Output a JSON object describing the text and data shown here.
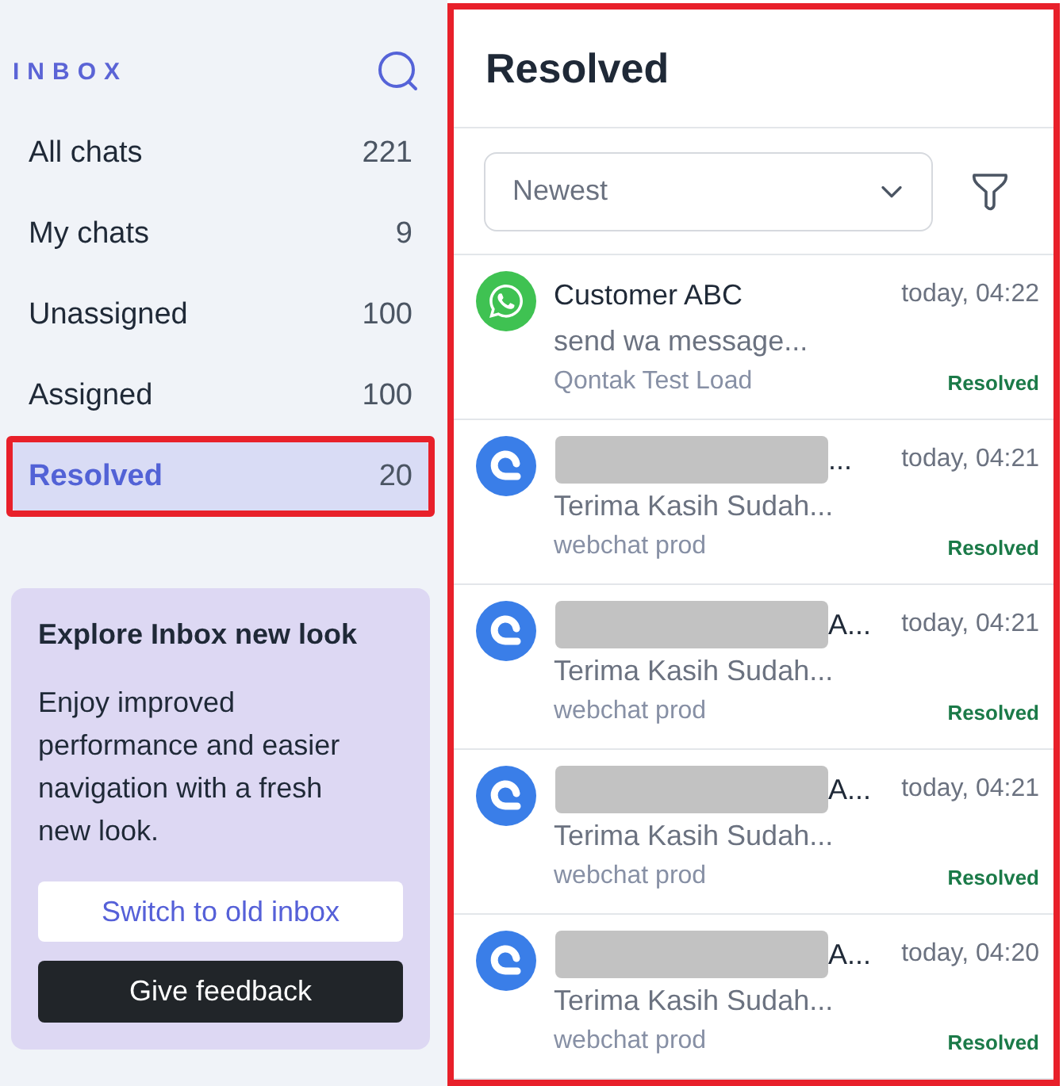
{
  "sidebar": {
    "title": "INBOX",
    "items": [
      {
        "label": "All chats",
        "count": "221",
        "selected": false,
        "highlighted": false
      },
      {
        "label": "My chats",
        "count": "9",
        "selected": false,
        "highlighted": false
      },
      {
        "label": "Unassigned",
        "count": "100",
        "selected": false,
        "highlighted": false
      },
      {
        "label": "Assigned",
        "count": "100",
        "selected": false,
        "highlighted": false
      },
      {
        "label": "Resolved",
        "count": "20",
        "selected": true,
        "highlighted": true
      }
    ]
  },
  "promo": {
    "title": "Explore Inbox new look",
    "text": "Enjoy improved performance and easier navigation with a fresh new look.",
    "buttons": [
      {
        "label": "Switch to old inbox",
        "kind": "secondary"
      },
      {
        "label": "Give feedback",
        "kind": "primary"
      }
    ]
  },
  "list_panel": {
    "highlighted": true,
    "title": "Resolved",
    "sort": {
      "value": "Newest"
    },
    "conversations": [
      {
        "kind": "whatsapp",
        "name": "Customer ABC",
        "redacted": false,
        "time": "today, 04:22",
        "message": "send wa message...",
        "source": "Qontak Test Load",
        "status": "Resolved"
      },
      {
        "kind": "webchat",
        "name": "...",
        "redacted": true,
        "time": "today, 04:21",
        "message": "Terima Kasih Sudah...",
        "source": "webchat prod",
        "status": "Resolved"
      },
      {
        "kind": "webchat",
        "name": "A...",
        "redacted": true,
        "time": "today, 04:21",
        "message": "Terima Kasih Sudah...",
        "source": "webchat prod",
        "status": "Resolved"
      },
      {
        "kind": "webchat",
        "name": "A...",
        "redacted": true,
        "time": "today, 04:21",
        "message": "Terima Kasih Sudah...",
        "source": "webchat prod",
        "status": "Resolved"
      },
      {
        "kind": "webchat",
        "name": "A...",
        "redacted": true,
        "time": "today, 04:20",
        "message": "Terima Kasih Sudah...",
        "source": "webchat prod",
        "status": "Resolved"
      }
    ]
  }
}
